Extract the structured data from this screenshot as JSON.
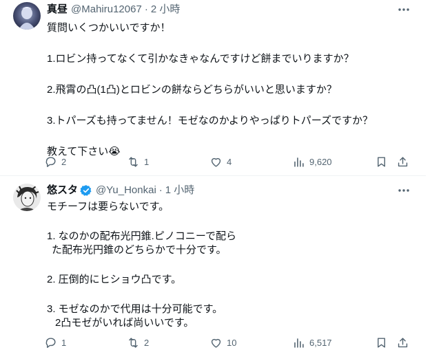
{
  "tweets": [
    {
      "display_name": "真昼",
      "handle": "@Mahiru12067",
      "separator": "·",
      "time": "2 小時",
      "lines": [
        "質問いくつかいいですか！",
        "1.ロビン持ってなくて引かなきゃなんですけど餅までいりますか？",
        "2.飛霄の凸(1凸)とロビンの餅ならどちらがいいと思いますか？",
        "3.トパーズも持ってません！モゼなのかよりやっぱりトパーズですか？",
        "教えて下さい😭"
      ],
      "counts": {
        "replies": "2",
        "retweets": "1",
        "likes": "4",
        "views": "9,620"
      }
    },
    {
      "display_name": "悠スタ",
      "handle": "@Yu_Honkai",
      "separator": "·",
      "time": "1 小時",
      "lines": [
        "モチーフは要らないです。",
        "1. なのかの配布光円錐.ピノコニーで配ら",
        "た配布光円錐のどちらかで十分です。",
        "2. 圧倒的にヒショウ凸です。",
        "3. モゼなのかで代用は十分可能です。",
        "2凸モゼがいれば尚いいです。"
      ],
      "counts": {
        "replies": "1",
        "retweets": "2",
        "likes": "10",
        "views": "6,517"
      }
    }
  ],
  "icons": [
    "more-icon",
    "verified-badge-icon",
    "reply-icon",
    "retweet-icon",
    "like-icon",
    "views-icon",
    "bookmark-icon",
    "share-icon"
  ],
  "colors": {
    "text": "#0f1419",
    "muted": "#536471",
    "verified": "#1d9bf0",
    "divider": "#eff3f4"
  }
}
